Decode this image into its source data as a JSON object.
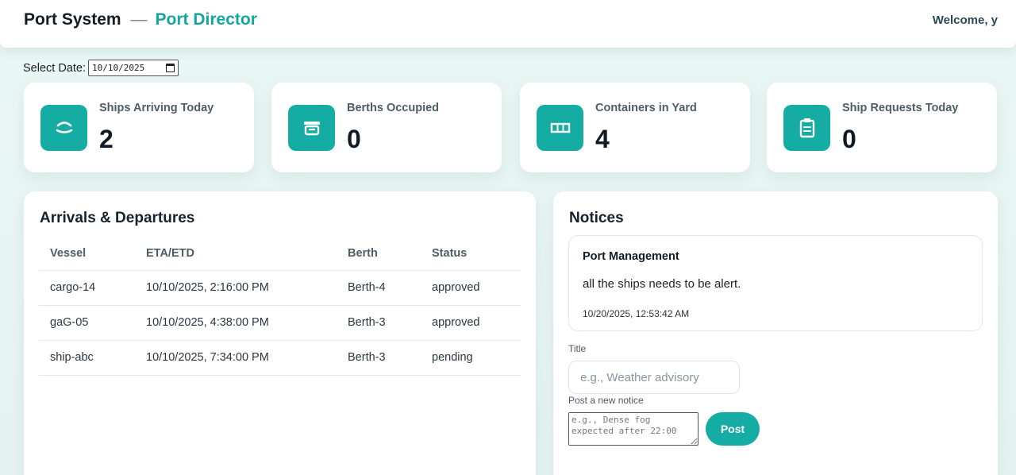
{
  "header": {
    "app_name": "Port System",
    "separator": "—",
    "role": "Port Director",
    "welcome": "Welcome, y"
  },
  "date_filter": {
    "label": "Select Date:",
    "value": "10/10/2025"
  },
  "stats": [
    {
      "label": "Ships Arriving Today",
      "value": "2",
      "icon": "ship-icon"
    },
    {
      "label": "Berths Occupied",
      "value": "0",
      "icon": "archive-box-icon"
    },
    {
      "label": "Containers in Yard",
      "value": "4",
      "icon": "container-icon"
    },
    {
      "label": "Ship Requests Today",
      "value": "0",
      "icon": "clipboard-icon"
    }
  ],
  "schedule": {
    "title": "Arrivals & Departures",
    "columns": [
      "Vessel",
      "ETA/ETD",
      "Berth",
      "Status"
    ],
    "rows": [
      {
        "vessel": "cargo-14",
        "eta": "10/10/2025, 2:16:00 PM",
        "berth": "Berth-4",
        "status": "approved"
      },
      {
        "vessel": "gaG-05",
        "eta": "10/10/2025, 4:38:00 PM",
        "berth": "Berth-3",
        "status": "approved"
      },
      {
        "vessel": "ship-abc",
        "eta": "10/10/2025, 7:34:00 PM",
        "berth": "Berth-3",
        "status": "pending"
      }
    ]
  },
  "notices": {
    "title": "Notices",
    "items": [
      {
        "author": "Port Management",
        "body": "all the ships needs to be alert.",
        "time": "10/20/2025, 12:53:42 AM"
      }
    ],
    "form": {
      "title_label": "Title",
      "title_placeholder": "e.g., Weather advisory",
      "notice_label": "Post a new notice",
      "notice_placeholder": "e.g., Dense fog expected after 22:00",
      "post_label": "Post"
    }
  },
  "colors": {
    "accent": "#15aca3",
    "background": "#e9f6f4"
  }
}
